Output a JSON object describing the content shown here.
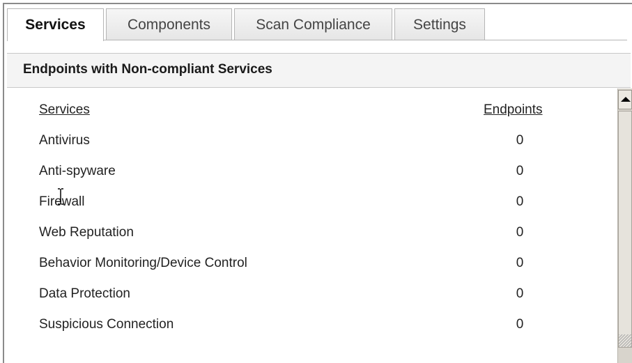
{
  "tabs": [
    {
      "label": "Services",
      "active": true
    },
    {
      "label": "Components",
      "active": false
    },
    {
      "label": "Scan Compliance",
      "active": false
    },
    {
      "label": "Settings",
      "active": false
    }
  ],
  "panel": {
    "title": "Endpoints with Non-compliant Services"
  },
  "table": {
    "headers": {
      "services": "Services",
      "endpoints": "Endpoints"
    },
    "rows": [
      {
        "service": "Antivirus",
        "endpoints": "0"
      },
      {
        "service": "Anti-spyware",
        "endpoints": "0"
      },
      {
        "service": "Firewall",
        "endpoints": "0"
      },
      {
        "service": "Web Reputation",
        "endpoints": "0"
      },
      {
        "service": "Behavior Monitoring/Device Control",
        "endpoints": "0"
      },
      {
        "service": "Data Protection",
        "endpoints": "0"
      },
      {
        "service": "Suspicious Connection",
        "endpoints": "0"
      }
    ]
  },
  "icons": {
    "scroll_up": "triangle-up-icon",
    "cursor": "text-cursor-icon"
  },
  "colors": {
    "tab_border": "#b5b5b5",
    "panel_header_bg": "#f4f4f4",
    "scrollbar_track": "#d8d4cc"
  }
}
